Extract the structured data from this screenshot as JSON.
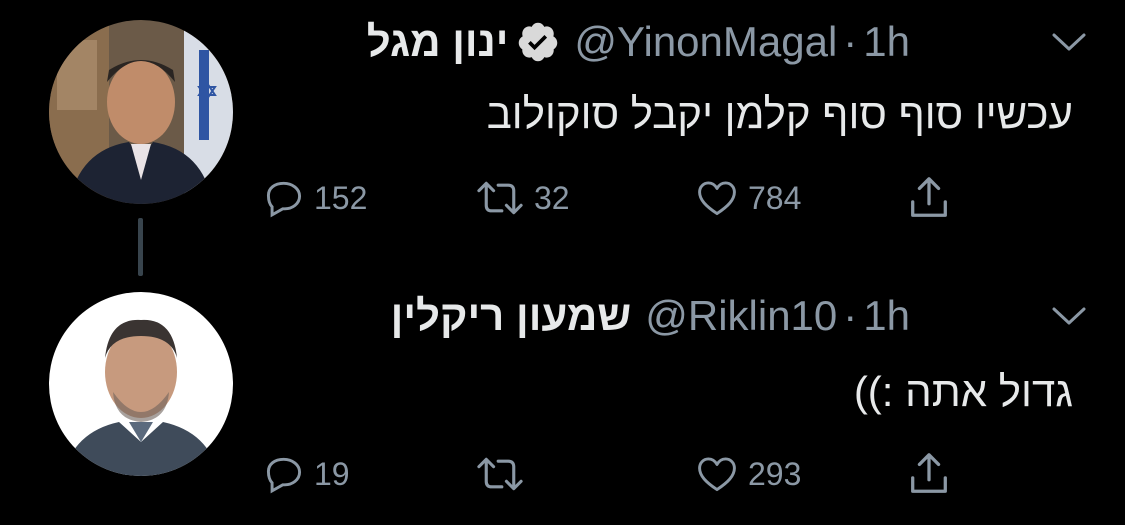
{
  "colors": {
    "background": "#000000",
    "text": "#e7e9ea",
    "muted": "#8b98a5",
    "verified": "#d9d9d9"
  },
  "tweets": [
    {
      "name": "ינון מגל",
      "verified": true,
      "handle": "@YinonMagal",
      "separator": "·",
      "time": "1h",
      "text": "עכשיו סוף סוף קלמן יקבל סוקולוב",
      "reply_count": "152",
      "retweet_count": "32",
      "like_count": "784",
      "icons": [
        "reply-icon",
        "retweet-icon",
        "like-icon",
        "share-icon",
        "chevron-down-icon",
        "verified-badge-icon"
      ]
    },
    {
      "name": "שמעון ריקלין",
      "verified": false,
      "handle": "@Riklin10",
      "separator": "·",
      "time": "1h",
      "text": "גדול אתה :))",
      "reply_count": "19",
      "retweet_count": "",
      "like_count": "293",
      "icons": [
        "reply-icon",
        "retweet-icon",
        "like-icon",
        "share-icon",
        "chevron-down-icon"
      ]
    }
  ]
}
